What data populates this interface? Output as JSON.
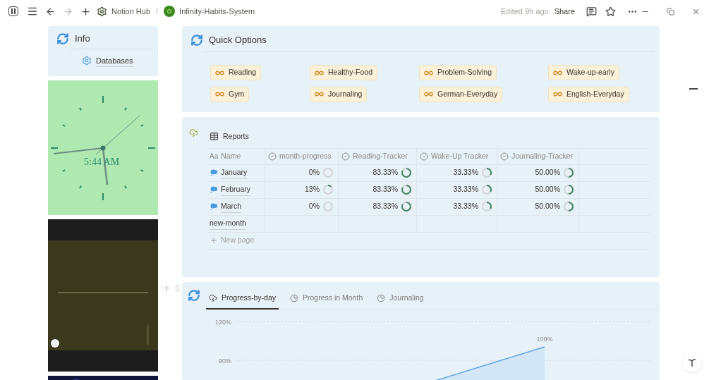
{
  "topbar": {
    "breadcrumbs": [
      {
        "label": "Notion Hub",
        "kind": "workspace"
      },
      {
        "label": "Infinity-Habits-System",
        "kind": "page"
      }
    ],
    "separator": "/",
    "edited": "Edited 9h ago",
    "share": "Share"
  },
  "info": {
    "title": "Info",
    "link": "Databases"
  },
  "clock": {
    "time": "5:44 AM"
  },
  "quick_options": {
    "title": "Quick Options",
    "items": [
      "Reading",
      "Healthy-Food",
      "Problem-Solving",
      "Wake-up-early",
      "Gym",
      "Journaling",
      "German-Everyday",
      "English-Everyday"
    ]
  },
  "reports": {
    "title": "Reports",
    "columns": [
      "Name",
      "month-progress",
      "Reading-Tracker",
      "Wake-Up Tracker",
      "Journaling-Tracker"
    ],
    "name_column_prefix": "Aa",
    "rows": [
      {
        "kind": "month",
        "cells": [
          "January",
          "0%",
          "83.33%",
          "33.33%",
          "50.00%"
        ]
      },
      {
        "kind": "month",
        "cells": [
          "February",
          "13%",
          "83.33%",
          "33.33%",
          "50.00%"
        ]
      },
      {
        "kind": "month",
        "cells": [
          "March",
          "0%",
          "83.33%",
          "33.33%",
          "50.00%"
        ]
      },
      {
        "kind": "plain",
        "cells": [
          "new-month"
        ]
      }
    ],
    "new_page": "New page"
  },
  "charts": {
    "tabs": [
      {
        "label": "Progress-by-day",
        "selected": true
      },
      {
        "label": "Progress in Month",
        "selected": false
      },
      {
        "label": "Journaling",
        "selected": false
      }
    ],
    "y_axis_labels": [
      "120%",
      "90%"
    ],
    "point_label": "100%"
  }
}
